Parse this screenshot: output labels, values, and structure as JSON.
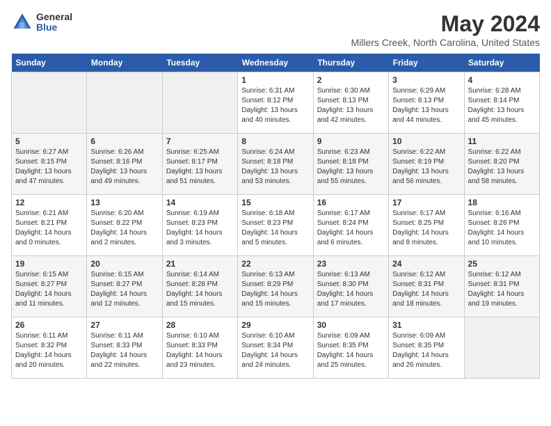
{
  "logo": {
    "general": "General",
    "blue": "Blue"
  },
  "title": "May 2024",
  "location": "Millers Creek, North Carolina, United States",
  "weekdays": [
    "Sunday",
    "Monday",
    "Tuesday",
    "Wednesday",
    "Thursday",
    "Friday",
    "Saturday"
  ],
  "weeks": [
    [
      {
        "day": "",
        "sunrise": "",
        "sunset": "",
        "daylight": ""
      },
      {
        "day": "",
        "sunrise": "",
        "sunset": "",
        "daylight": ""
      },
      {
        "day": "",
        "sunrise": "",
        "sunset": "",
        "daylight": ""
      },
      {
        "day": "1",
        "sunrise": "Sunrise: 6:31 AM",
        "sunset": "Sunset: 8:12 PM",
        "daylight": "Daylight: 13 hours and 40 minutes."
      },
      {
        "day": "2",
        "sunrise": "Sunrise: 6:30 AM",
        "sunset": "Sunset: 8:13 PM",
        "daylight": "Daylight: 13 hours and 42 minutes."
      },
      {
        "day": "3",
        "sunrise": "Sunrise: 6:29 AM",
        "sunset": "Sunset: 8:13 PM",
        "daylight": "Daylight: 13 hours and 44 minutes."
      },
      {
        "day": "4",
        "sunrise": "Sunrise: 6:28 AM",
        "sunset": "Sunset: 8:14 PM",
        "daylight": "Daylight: 13 hours and 45 minutes."
      }
    ],
    [
      {
        "day": "5",
        "sunrise": "Sunrise: 6:27 AM",
        "sunset": "Sunset: 8:15 PM",
        "daylight": "Daylight: 13 hours and 47 minutes."
      },
      {
        "day": "6",
        "sunrise": "Sunrise: 6:26 AM",
        "sunset": "Sunset: 8:16 PM",
        "daylight": "Daylight: 13 hours and 49 minutes."
      },
      {
        "day": "7",
        "sunrise": "Sunrise: 6:25 AM",
        "sunset": "Sunset: 8:17 PM",
        "daylight": "Daylight: 13 hours and 51 minutes."
      },
      {
        "day": "8",
        "sunrise": "Sunrise: 6:24 AM",
        "sunset": "Sunset: 8:18 PM",
        "daylight": "Daylight: 13 hours and 53 minutes."
      },
      {
        "day": "9",
        "sunrise": "Sunrise: 6:23 AM",
        "sunset": "Sunset: 8:18 PM",
        "daylight": "Daylight: 13 hours and 55 minutes."
      },
      {
        "day": "10",
        "sunrise": "Sunrise: 6:22 AM",
        "sunset": "Sunset: 8:19 PM",
        "daylight": "Daylight: 13 hours and 56 minutes."
      },
      {
        "day": "11",
        "sunrise": "Sunrise: 6:22 AM",
        "sunset": "Sunset: 8:20 PM",
        "daylight": "Daylight: 13 hours and 58 minutes."
      }
    ],
    [
      {
        "day": "12",
        "sunrise": "Sunrise: 6:21 AM",
        "sunset": "Sunset: 8:21 PM",
        "daylight": "Daylight: 14 hours and 0 minutes."
      },
      {
        "day": "13",
        "sunrise": "Sunrise: 6:20 AM",
        "sunset": "Sunset: 8:22 PM",
        "daylight": "Daylight: 14 hours and 2 minutes."
      },
      {
        "day": "14",
        "sunrise": "Sunrise: 6:19 AM",
        "sunset": "Sunset: 8:23 PM",
        "daylight": "Daylight: 14 hours and 3 minutes."
      },
      {
        "day": "15",
        "sunrise": "Sunrise: 6:18 AM",
        "sunset": "Sunset: 8:23 PM",
        "daylight": "Daylight: 14 hours and 5 minutes."
      },
      {
        "day": "16",
        "sunrise": "Sunrise: 6:17 AM",
        "sunset": "Sunset: 8:24 PM",
        "daylight": "Daylight: 14 hours and 6 minutes."
      },
      {
        "day": "17",
        "sunrise": "Sunrise: 6:17 AM",
        "sunset": "Sunset: 8:25 PM",
        "daylight": "Daylight: 14 hours and 8 minutes."
      },
      {
        "day": "18",
        "sunrise": "Sunrise: 6:16 AM",
        "sunset": "Sunset: 8:26 PM",
        "daylight": "Daylight: 14 hours and 10 minutes."
      }
    ],
    [
      {
        "day": "19",
        "sunrise": "Sunrise: 6:15 AM",
        "sunset": "Sunset: 8:27 PM",
        "daylight": "Daylight: 14 hours and 11 minutes."
      },
      {
        "day": "20",
        "sunrise": "Sunrise: 6:15 AM",
        "sunset": "Sunset: 8:27 PM",
        "daylight": "Daylight: 14 hours and 12 minutes."
      },
      {
        "day": "21",
        "sunrise": "Sunrise: 6:14 AM",
        "sunset": "Sunset: 8:28 PM",
        "daylight": "Daylight: 14 hours and 15 minutes."
      },
      {
        "day": "22",
        "sunrise": "Sunrise: 6:13 AM",
        "sunset": "Sunset: 8:29 PM",
        "daylight": "Daylight: 14 hours and 15 minutes."
      },
      {
        "day": "23",
        "sunrise": "Sunrise: 6:13 AM",
        "sunset": "Sunset: 8:30 PM",
        "daylight": "Daylight: 14 hours and 17 minutes."
      },
      {
        "day": "24",
        "sunrise": "Sunrise: 6:12 AM",
        "sunset": "Sunset: 8:31 PM",
        "daylight": "Daylight: 14 hours and 18 minutes."
      },
      {
        "day": "25",
        "sunrise": "Sunrise: 6:12 AM",
        "sunset": "Sunset: 8:31 PM",
        "daylight": "Daylight: 14 hours and 19 minutes."
      }
    ],
    [
      {
        "day": "26",
        "sunrise": "Sunrise: 6:11 AM",
        "sunset": "Sunset: 8:32 PM",
        "daylight": "Daylight: 14 hours and 20 minutes."
      },
      {
        "day": "27",
        "sunrise": "Sunrise: 6:11 AM",
        "sunset": "Sunset: 8:33 PM",
        "daylight": "Daylight: 14 hours and 22 minutes."
      },
      {
        "day": "28",
        "sunrise": "Sunrise: 6:10 AM",
        "sunset": "Sunset: 8:33 PM",
        "daylight": "Daylight: 14 hours and 23 minutes."
      },
      {
        "day": "29",
        "sunrise": "Sunrise: 6:10 AM",
        "sunset": "Sunset: 8:34 PM",
        "daylight": "Daylight: 14 hours and 24 minutes."
      },
      {
        "day": "30",
        "sunrise": "Sunrise: 6:09 AM",
        "sunset": "Sunset: 8:35 PM",
        "daylight": "Daylight: 14 hours and 25 minutes."
      },
      {
        "day": "31",
        "sunrise": "Sunrise: 6:09 AM",
        "sunset": "Sunset: 8:35 PM",
        "daylight": "Daylight: 14 hours and 26 minutes."
      },
      {
        "day": "",
        "sunrise": "",
        "sunset": "",
        "daylight": ""
      }
    ]
  ]
}
